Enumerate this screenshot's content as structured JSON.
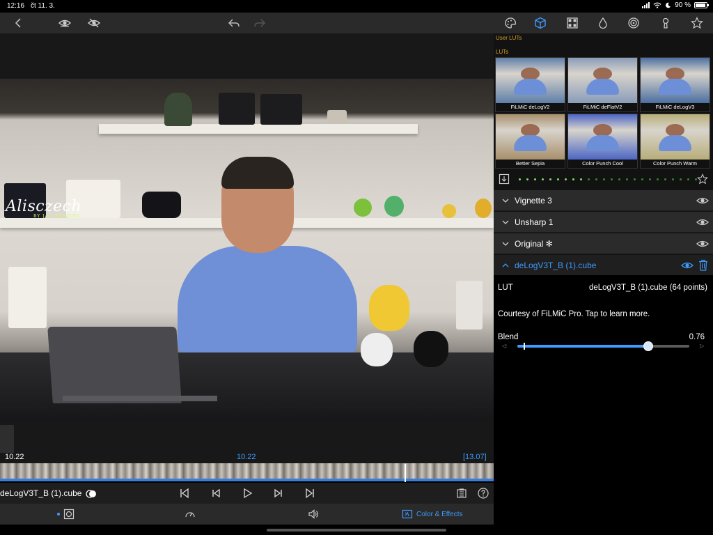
{
  "status": {
    "time": "12:16",
    "date": "čt 11. 3.",
    "battery": "90 %"
  },
  "viewer": {
    "watermark": "Alisczech",
    "watermark_sub": "BY JAN BŘEZINA"
  },
  "timeline": {
    "start": "10.22",
    "current": "10.22",
    "end": "[13.07]",
    "clip_name": "deLogV3T_B (1).cube"
  },
  "bottombar": {
    "color_effects_label": "Color & Effects"
  },
  "panel": {
    "user_luts_header": "User LUTs",
    "luts_header": "LUTs",
    "luts": [
      {
        "name": "FiLMiC deLogV2",
        "tint": "#5f7fa8"
      },
      {
        "name": "FiLMiC deFlatV2",
        "tint": "#8a9cb8"
      },
      {
        "name": "FiLMiC deLogV3",
        "tint": "#4c6fa0"
      },
      {
        "name": "Better Sepia",
        "tint": "#a8906c"
      },
      {
        "name": "Color Punch Cool",
        "tint": "#4d66c4"
      },
      {
        "name": "Color Punch Warm",
        "tint": "#b8ae7a"
      }
    ],
    "layers": [
      {
        "label": "Vignette 3"
      },
      {
        "label": "Unsharp 1"
      },
      {
        "label": "Original ✻"
      },
      {
        "label": "deLogV3T_B (1).cube"
      }
    ],
    "detail": {
      "lut_key": "LUT",
      "lut_value": "deLogV3T_B (1).cube (64 points)",
      "courtesy": "Courtesy of FiLMiC Pro. Tap to learn more.",
      "blend_label": "Blend",
      "blend_value": "0.76",
      "blend_fraction": 0.76
    }
  },
  "colors": {
    "accent": "#3f9bff",
    "section_header": "#d6a12a",
    "timeline_blue": "#3c7dd8"
  }
}
